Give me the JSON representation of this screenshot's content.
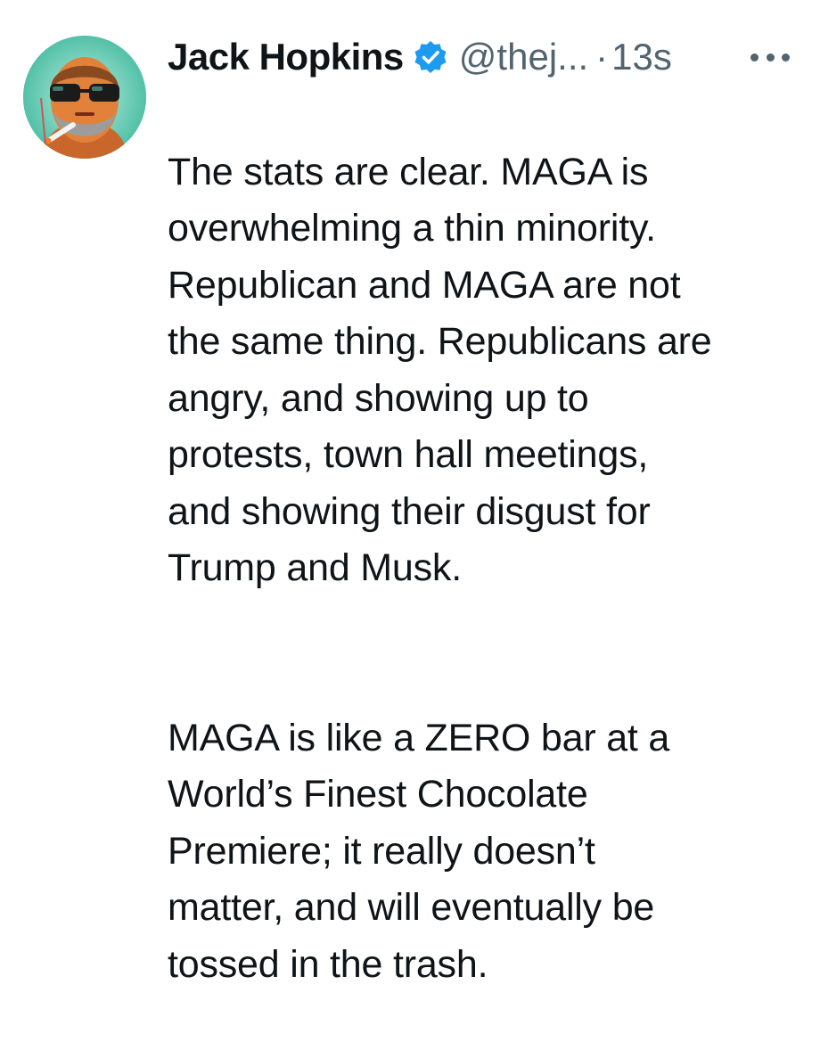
{
  "tweet": {
    "author_name": "Jack Hopkins",
    "handle": "@thej...",
    "separator": "·",
    "timestamp": "13s",
    "verified": true,
    "verified_icon": "verified-badge-icon",
    "more_icon": "more-options-icon",
    "avatar_icon": "user-avatar-image",
    "accent_color": "#1d9bf0",
    "paragraphs": [
      "The stats are clear. MAGA is\noverwhelming a thin minority.\nRepublican and MAGA are not\nthe same thing. Republicans are\nangry, and showing up to\nprotests, town hall meetings,\nand showing their disgust for\nTrump and Musk.",
      "MAGA is like a ZERO bar at a\nWorld’s Finest Chocolate\nPremiere; it really doesn’t\nmatter, and will eventually be\ntossed in the trash."
    ]
  }
}
